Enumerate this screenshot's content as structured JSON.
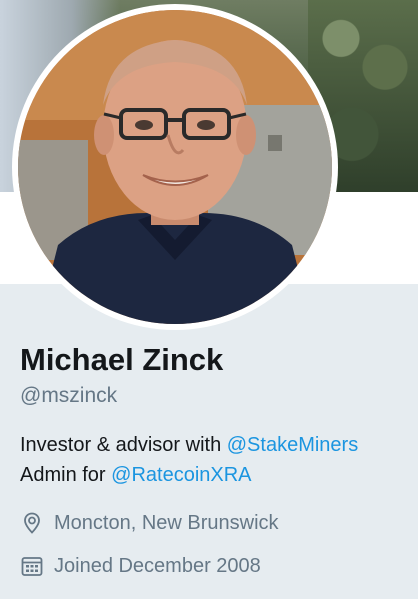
{
  "profile": {
    "name": "Michael Zinck",
    "handle": "@mszinck",
    "bio": {
      "line1_text": "Investor & advisor with ",
      "line1_link": "@StakeMiners",
      "line2_text": "Admin for ",
      "line2_link": "@RatecoinXRA"
    },
    "location": "Moncton, New Brunswick",
    "joined": "Joined December 2008"
  },
  "icons": {
    "location": "map-pin-icon",
    "joined": "calendar-icon"
  },
  "colors": {
    "page_bg": "#e6ecf0",
    "link": "#1b95e0",
    "muted_text": "#657786",
    "primary_text": "#14171a"
  }
}
